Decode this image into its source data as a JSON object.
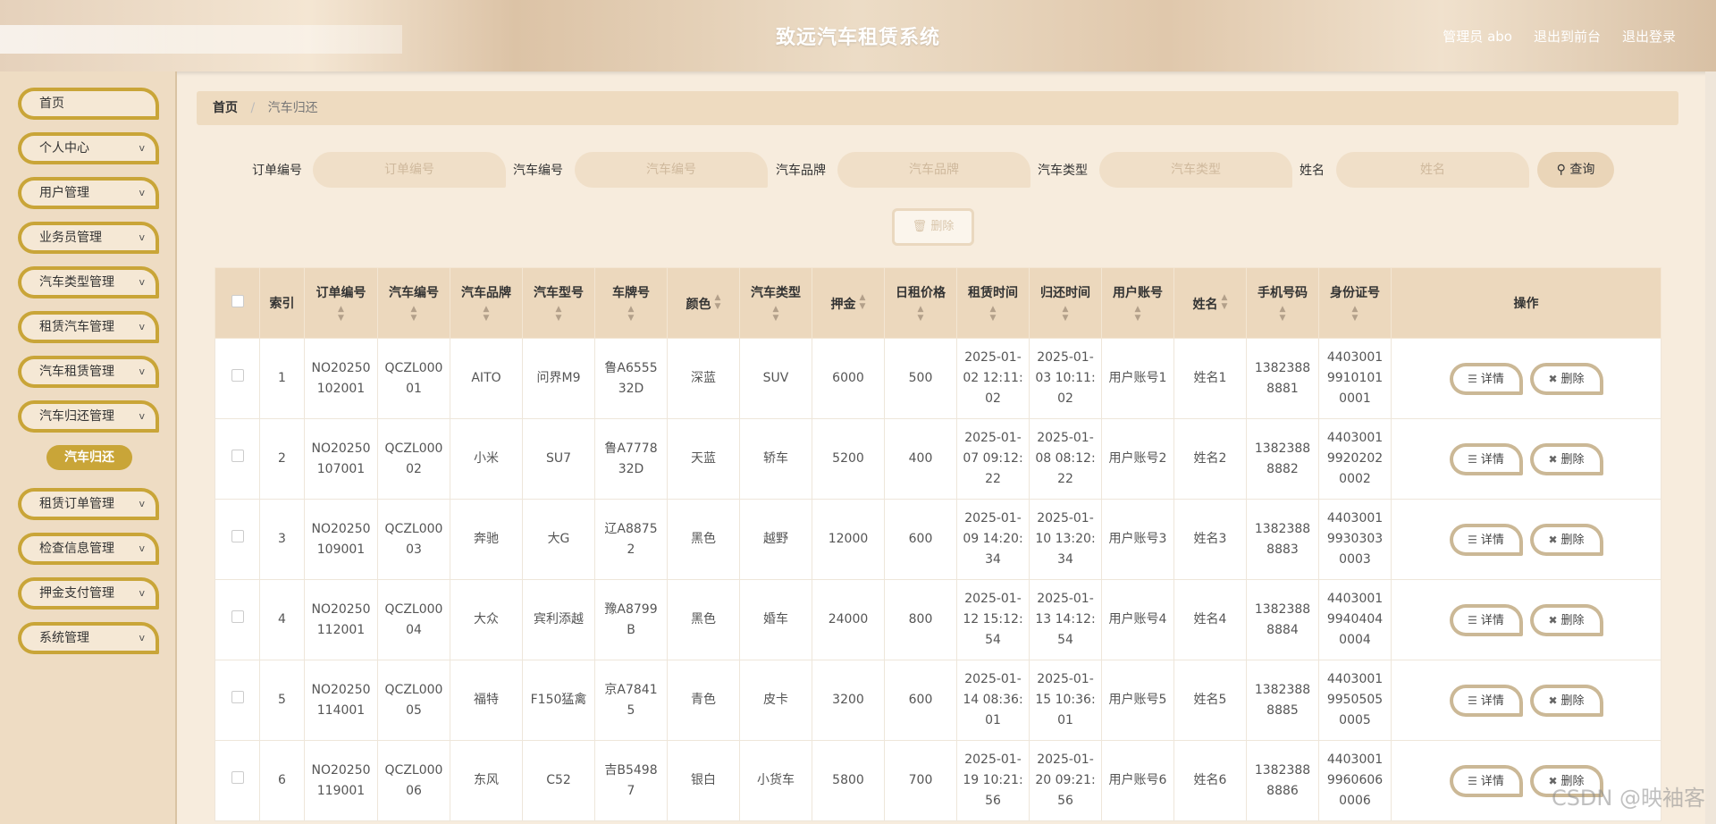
{
  "header": {
    "title": "致远汽车租赁系统",
    "user_label": "管理员 abo",
    "front_label": "退出到前台",
    "logout_label": "退出登录"
  },
  "sidebar": {
    "items": [
      {
        "label": "首页",
        "expandable": false
      },
      {
        "label": "个人中心",
        "expandable": true
      },
      {
        "label": "用户管理",
        "expandable": true
      },
      {
        "label": "业务员管理",
        "expandable": true
      },
      {
        "label": "汽车类型管理",
        "expandable": true
      },
      {
        "label": "租赁汽车管理",
        "expandable": true
      },
      {
        "label": "汽车租赁管理",
        "expandable": true
      },
      {
        "label": "汽车归还管理",
        "expandable": true
      },
      {
        "label": "租赁订单管理",
        "expandable": true
      },
      {
        "label": "检查信息管理",
        "expandable": true
      },
      {
        "label": "押金支付管理",
        "expandable": true
      },
      {
        "label": "系统管理",
        "expandable": true
      }
    ],
    "active_sub": "汽车归还"
  },
  "breadcrumb": {
    "home": "首页",
    "current": "汽车归还"
  },
  "search": {
    "fields": [
      {
        "label": "订单编号",
        "placeholder": "订单编号"
      },
      {
        "label": "汽车编号",
        "placeholder": "汽车编号"
      },
      {
        "label": "汽车品牌",
        "placeholder": "汽车品牌"
      },
      {
        "label": "汽车类型",
        "placeholder": "汽车类型"
      },
      {
        "label": "姓名",
        "placeholder": "姓名"
      }
    ],
    "query_label": "查询"
  },
  "bulk_delete_label": "删除",
  "table": {
    "headers": [
      "索引",
      "订单编号",
      "汽车编号",
      "汽车品牌",
      "汽车型号",
      "车牌号",
      "颜色",
      "汽车类型",
      "押金",
      "日租价格",
      "租赁时间",
      "归还时间",
      "用户账号",
      "姓名",
      "手机号码",
      "身份证号",
      "操作"
    ],
    "detail_label": "详情",
    "delete_label": "删除",
    "rows": [
      [
        "1",
        "NO20250102001",
        "QCZL00001",
        "AITO",
        "问界M9",
        "鲁A655532D",
        "深蓝",
        "SUV",
        "6000",
        "500",
        "2025-01-02 12:11:02",
        "2025-01-03 10:11:02",
        "用户账号1",
        "姓名1",
        "13823888881",
        "440300199101010001"
      ],
      [
        "2",
        "NO20250107001",
        "QCZL00002",
        "小米",
        "SU7",
        "鲁A777832D",
        "天蓝",
        "轿车",
        "5200",
        "400",
        "2025-01-07 09:12:22",
        "2025-01-08 08:12:22",
        "用户账号2",
        "姓名2",
        "13823888882",
        "440300199202020002"
      ],
      [
        "3",
        "NO20250109001",
        "QCZL00003",
        "奔驰",
        "大G",
        "辽A88752",
        "黑色",
        "越野",
        "12000",
        "600",
        "2025-01-09 14:20:34",
        "2025-01-10 13:20:34",
        "用户账号3",
        "姓名3",
        "13823888883",
        "440300199303030003"
      ],
      [
        "4",
        "NO20250112001",
        "QCZL00004",
        "大众",
        "宾利添越",
        "豫A8799B",
        "黑色",
        "婚车",
        "24000",
        "800",
        "2025-01-12 15:12:54",
        "2025-01-13 14:12:54",
        "用户账号4",
        "姓名4",
        "13823888884",
        "440300199404040004"
      ],
      [
        "5",
        "NO20250114001",
        "QCZL00005",
        "福特",
        "F150猛禽",
        "京A78415",
        "青色",
        "皮卡",
        "3200",
        "600",
        "2025-01-14 08:36:01",
        "2025-01-15 10:36:01",
        "用户账号5",
        "姓名5",
        "13823888885",
        "440300199505050005"
      ],
      [
        "6",
        "NO20250119001",
        "QCZL00006",
        "东风",
        "C52",
        "吉B54987",
        "银白",
        "小货车",
        "5800",
        "700",
        "2025-01-19 10:21:56",
        "2025-01-20 09:21:56",
        "用户账号6",
        "姓名6",
        "13823888886",
        "440300199606060006"
      ]
    ]
  },
  "watermark": "CSDN @映袖客",
  "colors": {
    "accent": "#c9a538",
    "header_bg": "#e8d5bf",
    "table_header": "#ecd8bd"
  }
}
